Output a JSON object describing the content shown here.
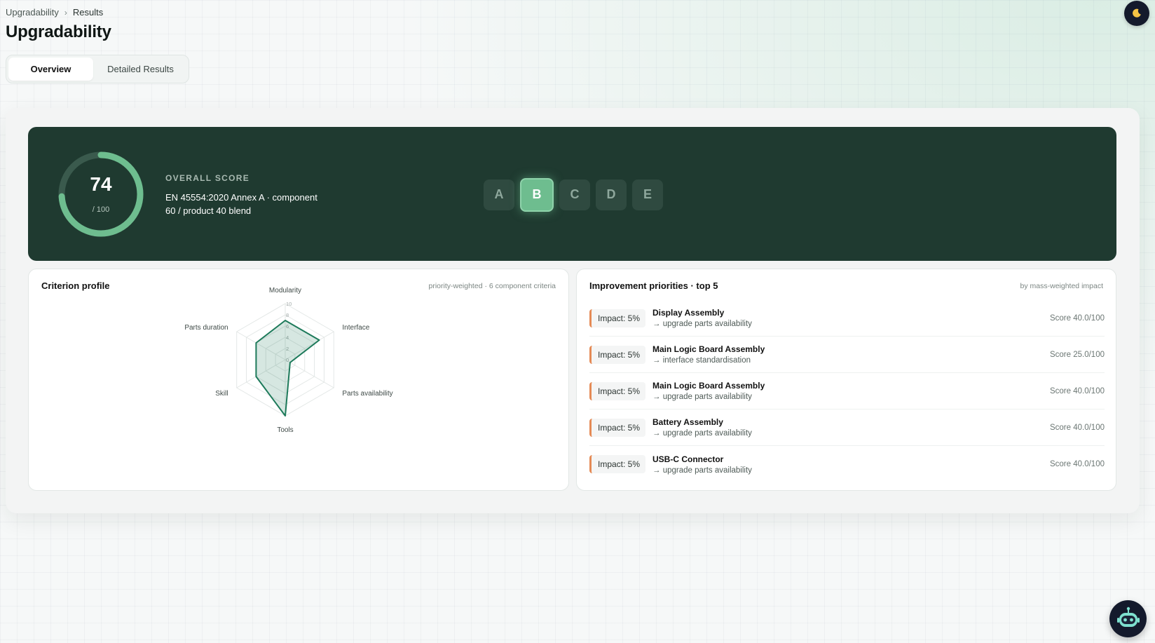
{
  "breadcrumb": {
    "parent": "Upgradability",
    "separator": "›",
    "current": "Results"
  },
  "page": {
    "title": "Upgradability"
  },
  "tabs": [
    {
      "label": "Overview",
      "active": true
    },
    {
      "label": "Detailed Results",
      "active": false
    }
  ],
  "colors": {
    "hero_bg": "#1f3a30",
    "accent": "#6ebd8f",
    "radar_stroke": "#1d7a5a",
    "impact_bar": "#e58a55"
  },
  "overall": {
    "score": 74,
    "score_fraction": 0.74,
    "suffix": "/ 100",
    "label": "OVERALL SCORE",
    "description": "EN 45554:2020 Annex A · component 60 / product 40 blend"
  },
  "grades": {
    "letters": [
      "A",
      "B",
      "C",
      "D",
      "E"
    ],
    "active": "B"
  },
  "criterion_profile": {
    "title": "Criterion profile",
    "subtitle": "priority-weighted · 6 component criteria"
  },
  "chart_data": {
    "type": "radar",
    "categories": [
      "Modularity",
      "Interface",
      "Parts availability",
      "Tools",
      "Skill",
      "Parts duration"
    ],
    "values": [
      7,
      7,
      1,
      10,
      6,
      6
    ],
    "range": [
      0,
      10
    ],
    "ticks": [
      "0",
      "2",
      "4",
      "6",
      "8",
      "10"
    ]
  },
  "improvements": {
    "title": "Improvement priorities · top 5",
    "subtitle": "by mass-weighted impact",
    "items": [
      {
        "impact": "Impact: 5%",
        "name": "Display Assembly",
        "action": "→ upgrade parts availability",
        "score": "Score 40.0/100"
      },
      {
        "impact": "Impact: 5%",
        "name": "Main Logic Board Assembly",
        "action": "→ interface standardisation",
        "score": "Score 25.0/100"
      },
      {
        "impact": "Impact: 5%",
        "name": "Main Logic Board Assembly",
        "action": "→ upgrade parts availability",
        "score": "Score 40.0/100"
      },
      {
        "impact": "Impact: 5%",
        "name": "Battery Assembly",
        "action": "→ upgrade parts availability",
        "score": "Score 40.0/100"
      },
      {
        "impact": "Impact: 5%",
        "name": "USB-C Connector",
        "action": "→ upgrade parts availability",
        "score": "Score 40.0/100"
      }
    ]
  },
  "icons": {
    "theme_toggle": "moon-icon",
    "assistant": "robot-icon"
  }
}
